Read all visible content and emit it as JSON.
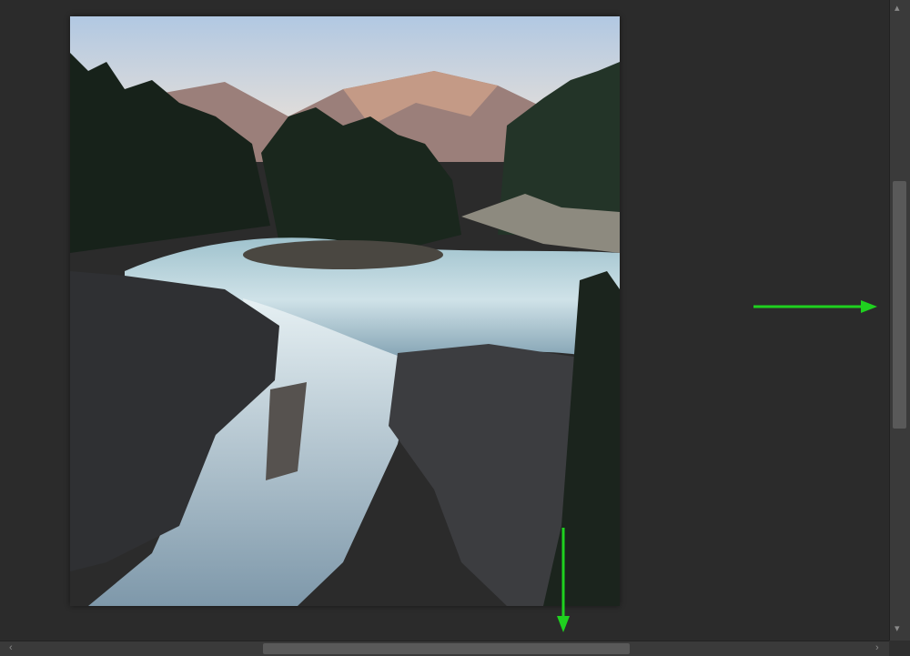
{
  "image": {
    "subject": "waterfall-landscape",
    "colors": {
      "sky_top": "#b7cde4",
      "sky_bottom": "#e8ddd5",
      "mountain": "#9a7e78",
      "forest": "#1e2a20",
      "water": "#b9d3dc",
      "rock": "#3a3b3d"
    }
  },
  "scrollbars": {
    "vertical": {
      "up_glyph": "▴",
      "down_glyph": "▾"
    },
    "horizontal": {
      "left_glyph": "‹",
      "right_glyph": "›"
    }
  },
  "annotations": {
    "color": "#1fd11f",
    "arrows": [
      "right-arrow",
      "down-arrow"
    ]
  },
  "ui_colors": {
    "canvas": "#2b2b2b",
    "scrollbar_track": "#3a3a3a",
    "scrollbar_thumb": "#595959"
  }
}
